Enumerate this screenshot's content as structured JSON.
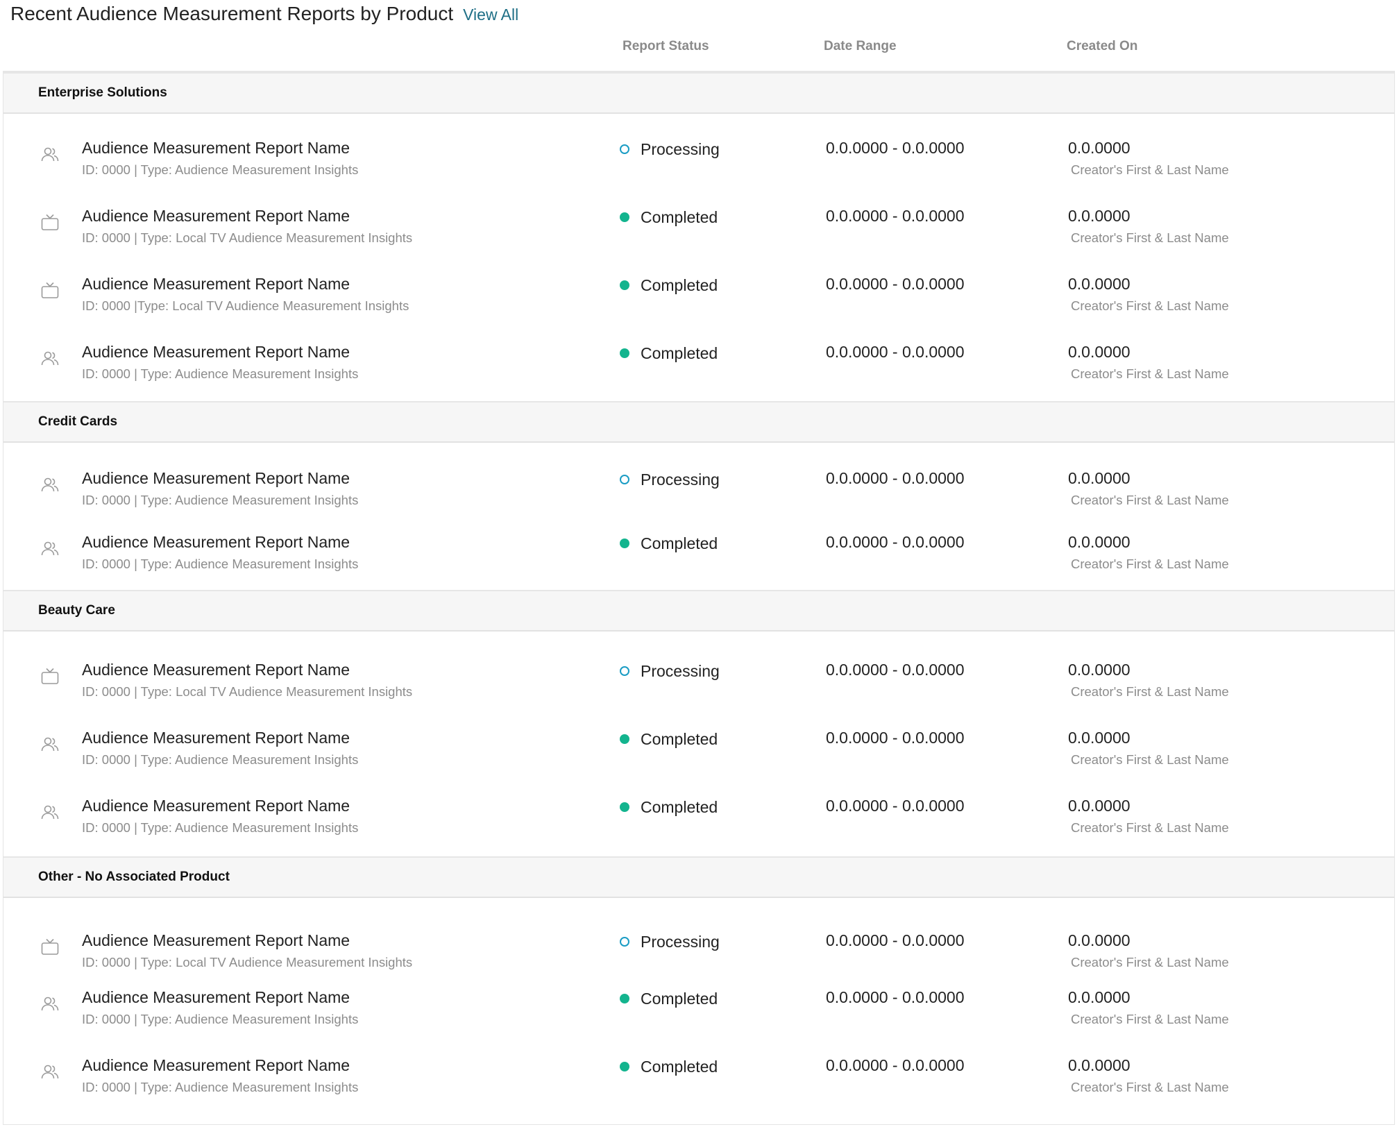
{
  "header": {
    "title": "Recent Audience Measurement Reports by Product",
    "view_all": "View All"
  },
  "columns": {
    "status": "Report Status",
    "date_range": "Date Range",
    "created_on": "Created On"
  },
  "groups": [
    {
      "name": "Enterprise Solutions",
      "reports": [
        {
          "icon": "audience-icon",
          "name": "Audience Measurement Report Name",
          "meta": "ID: 0000 | Type: Audience Measurement Insights",
          "status": "Processing",
          "date_range": "0.0.0000 - 0.0.0000",
          "created_on": "0.0.0000",
          "creator": "Creator's First & Last Name"
        },
        {
          "icon": "tv-icon",
          "name": "Audience Measurement Report Name",
          "meta": "ID: 0000 | Type: Local TV Audience Measurement Insights",
          "status": "Completed",
          "date_range": "0.0.0000 - 0.0.0000",
          "created_on": "0.0.0000",
          "creator": "Creator's First & Last Name"
        },
        {
          "icon": "tv-icon",
          "name": "Audience Measurement Report Name",
          "meta": "ID: 0000 |Type: Local TV Audience Measurement Insights",
          "status": "Completed",
          "date_range": "0.0.0000 - 0.0.0000",
          "created_on": "0.0.0000",
          "creator": "Creator's First & Last Name"
        },
        {
          "icon": "audience-icon",
          "name": "Audience Measurement Report Name",
          "meta": "ID: 0000 | Type: Audience Measurement Insights",
          "status": "Completed",
          "date_range": "0.0.0000 - 0.0.0000",
          "created_on": "0.0.0000",
          "creator": "Creator's First & Last Name"
        }
      ]
    },
    {
      "name": "Credit Cards",
      "reports": [
        {
          "icon": "audience-icon",
          "name": "Audience Measurement Report Name",
          "meta": "ID: 0000 | Type: Audience Measurement Insights",
          "status": "Processing",
          "date_range": "0.0.0000 - 0.0.0000",
          "created_on": "0.0.0000",
          "creator": "Creator's First & Last Name"
        },
        {
          "icon": "audience-icon",
          "name": "Audience Measurement Report Name",
          "meta": "ID: 0000 | Type: Audience Measurement Insights",
          "status": "Completed",
          "date_range": "0.0.0000 - 0.0.0000",
          "created_on": "0.0.0000",
          "creator": "Creator's First & Last Name"
        }
      ]
    },
    {
      "name": "Beauty Care",
      "reports": [
        {
          "icon": "tv-icon",
          "name": "Audience Measurement Report Name",
          "meta": "ID: 0000 | Type: Local TV Audience Measurement Insights",
          "status": "Processing",
          "date_range": "0.0.0000 - 0.0.0000",
          "created_on": "0.0.0000",
          "creator": "Creator's First & Last Name"
        },
        {
          "icon": "audience-icon",
          "name": "Audience Measurement Report Name",
          "meta": "ID: 0000 | Type: Audience Measurement Insights",
          "status": "Completed",
          "date_range": "0.0.0000 - 0.0.0000",
          "created_on": "0.0.0000",
          "creator": "Creator's First & Last Name"
        },
        {
          "icon": "audience-icon",
          "name": "Audience Measurement Report Name",
          "meta": "ID: 0000 | Type: Audience Measurement Insights",
          "status": "Completed",
          "date_range": "0.0.0000 - 0.0.0000",
          "created_on": "0.0.0000",
          "creator": "Creator's First & Last Name"
        }
      ]
    },
    {
      "name": "Other - No Associated Product",
      "reports": [
        {
          "icon": "tv-icon",
          "name": "Audience Measurement Report Name",
          "meta": "ID: 0000 | Type: Local TV Audience Measurement Insights",
          "status": "Processing",
          "date_range": "0.0.0000 - 0.0.0000",
          "created_on": "0.0.0000",
          "creator": "Creator's First & Last Name"
        },
        {
          "icon": "audience-icon",
          "name": "Audience Measurement Report Name",
          "meta": "ID: 0000 | Type: Audience Measurement Insights",
          "status": "Completed",
          "date_range": "0.0.0000 - 0.0.0000",
          "created_on": "0.0.0000",
          "creator": "Creator's First & Last Name"
        },
        {
          "icon": "audience-icon",
          "name": "Audience Measurement Report Name",
          "meta": "ID: 0000 | Type: Audience Measurement Insights",
          "status": "Completed",
          "date_range": "0.0.0000 - 0.0.0000",
          "created_on": "0.0.0000",
          "creator": "Creator's First & Last Name"
        }
      ]
    }
  ],
  "colors": {
    "link": "#1f6f86",
    "completed": "#13b48e",
    "processing": "#1a9cc4"
  }
}
